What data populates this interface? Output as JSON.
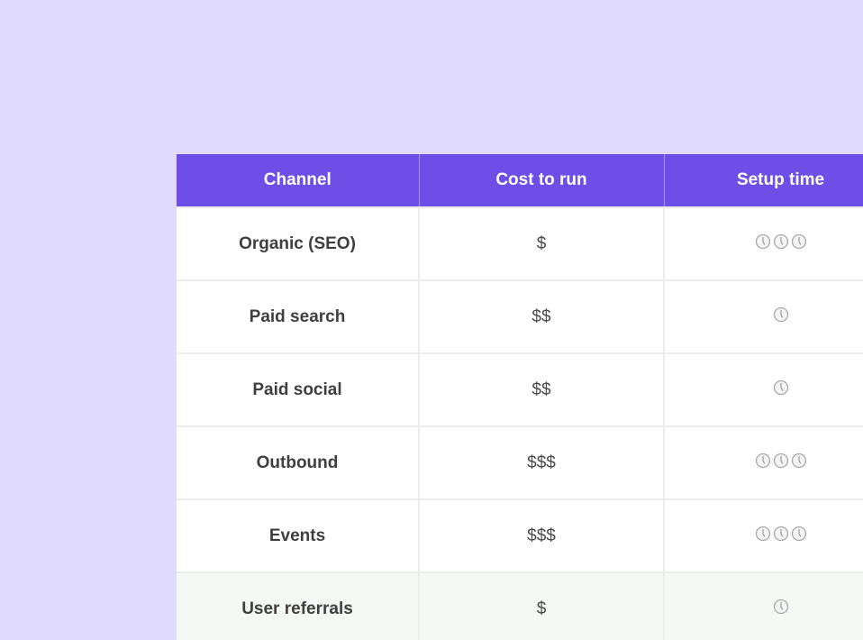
{
  "table": {
    "headers": [
      "Channel",
      "Cost to run",
      "Setup time"
    ],
    "rows": [
      {
        "channel": "Organic (SEO)",
        "cost": "$",
        "setup_clocks": 3,
        "highlight": false
      },
      {
        "channel": "Paid search",
        "cost": "$$",
        "setup_clocks": 1,
        "highlight": false
      },
      {
        "channel": "Paid social",
        "cost": "$$",
        "setup_clocks": 1,
        "highlight": false
      },
      {
        "channel": "Outbound",
        "cost": "$$$",
        "setup_clocks": 3,
        "highlight": false
      },
      {
        "channel": "Events",
        "cost": "$$$",
        "setup_clocks": 3,
        "highlight": false
      },
      {
        "channel": "User referrals",
        "cost": "$",
        "setup_clocks": 1,
        "highlight": true
      }
    ]
  },
  "colors": {
    "background": "#e0daff",
    "header": "#6d4fe8",
    "highlight_row": "#f5f9f6"
  },
  "icons": {
    "setup_time": "clock-icon"
  }
}
